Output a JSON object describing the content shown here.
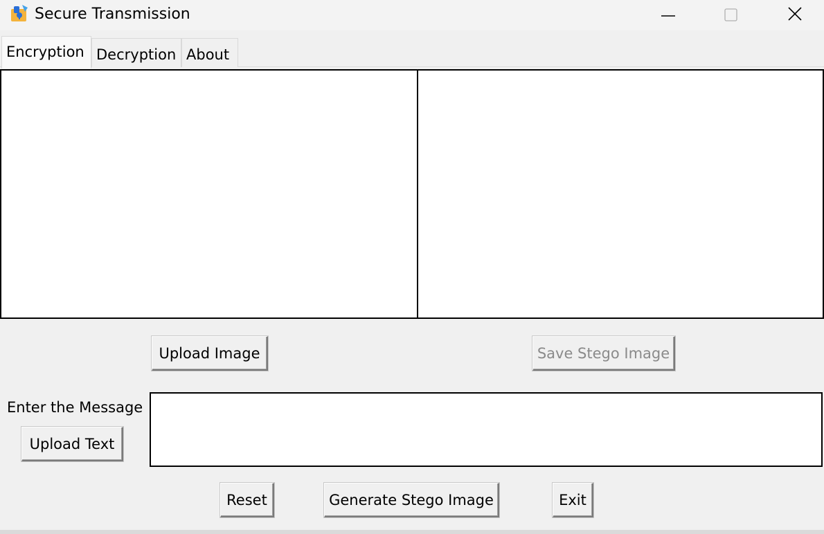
{
  "window": {
    "title": "Secure Transmission",
    "icon": "app-lock-icon"
  },
  "tabs": [
    {
      "label": "Encryption",
      "active": true
    },
    {
      "label": "Decryption",
      "active": false
    },
    {
      "label": "About",
      "active": false
    }
  ],
  "encryption": {
    "upload_image_label": "Upload Image",
    "save_stego_label": "Save Stego Image",
    "message_label": "Enter the Message",
    "upload_text_label": "Upload Text",
    "message_value": "",
    "reset_label": "Reset",
    "generate_label": "Generate Stego Image",
    "exit_label": "Exit"
  },
  "colors": {
    "window_bg": "#f0f0f0",
    "canvas_bg": "#ffffff",
    "disabled_text": "#8a8a8a"
  }
}
